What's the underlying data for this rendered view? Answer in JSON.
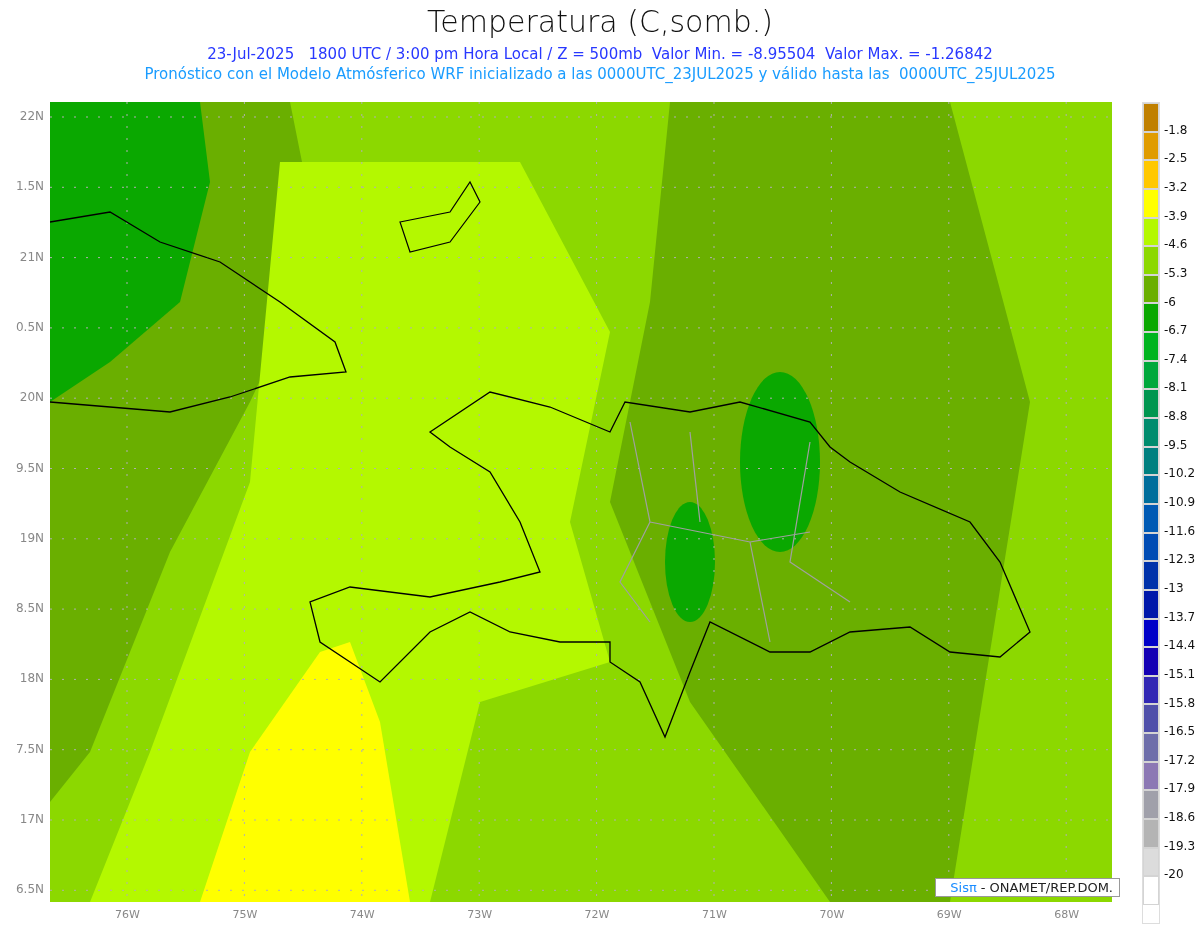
{
  "title": "Temperatura (C,somb.)",
  "subtitle": "23-Jul-2025   1800 UTC / 3:00 pm Hora Local / Z = 500mb  Valor Min. = -8.95504  Valor Max. = -1.26842",
  "description": "Pronóstico con el Modelo Atmósferico WRF inicializado a las 0000UTC_23JUL2025 y válido hasta las  0000UTC_25JUL2025",
  "y_axis_labels": [
    "22N",
    "1.5N",
    "21N",
    "0.5N",
    "20N",
    "9.5N",
    "19N",
    "8.5N",
    "18N",
    "7.5N",
    "17N",
    "6.5N"
  ],
  "x_axis_labels": [
    "76W",
    "75W",
    "74W",
    "73W",
    "72W",
    "71W",
    "70W",
    "69W",
    "68W"
  ],
  "credit": {
    "logo": "Sisπ",
    "text": "- ONAMET/REP.DOM."
  },
  "legend": {
    "bins": [
      {
        "color": "#c08000"
      },
      {
        "color": "#e09c00"
      },
      {
        "color": "#ffc800"
      },
      {
        "color": "#ffff00"
      },
      {
        "color": "#b4f800"
      },
      {
        "color": "#8cd800"
      },
      {
        "color": "#6aaf00"
      },
      {
        "color": "#0aa800"
      },
      {
        "color": "#00b41e"
      },
      {
        "color": "#00a83c"
      },
      {
        "color": "#009650"
      },
      {
        "color": "#008c6e"
      },
      {
        "color": "#008080"
      },
      {
        "color": "#006e9c"
      },
      {
        "color": "#005ab4"
      },
      {
        "color": "#004cb4"
      },
      {
        "color": "#0032aa"
      },
      {
        "color": "#0018aa"
      },
      {
        "color": "#0000c8"
      },
      {
        "color": "#1400b4"
      },
      {
        "color": "#3228b4"
      },
      {
        "color": "#5050aa"
      },
      {
        "color": "#6e6eaa"
      },
      {
        "color": "#8c78b4"
      },
      {
        "color": "#a0a0aa"
      },
      {
        "color": "#b4b4b4"
      },
      {
        "color": "#dcdcdc"
      },
      {
        "color": "#ffffff"
      }
    ],
    "labels": [
      "-1.8",
      "-2.5",
      "-3.2",
      "-3.9",
      "-4.6",
      "-5.3",
      "-6",
      "-6.7",
      "-7.4",
      "-8.1",
      "-8.8",
      "-9.5",
      "-10.2",
      "-10.9",
      "-11.6",
      "-12.3",
      "-13",
      "-13.7",
      "-14.4",
      "-15.1",
      "-15.8",
      "-16.5",
      "-17.2",
      "-17.9",
      "-18.6",
      "-19.3",
      "-20"
    ]
  }
}
